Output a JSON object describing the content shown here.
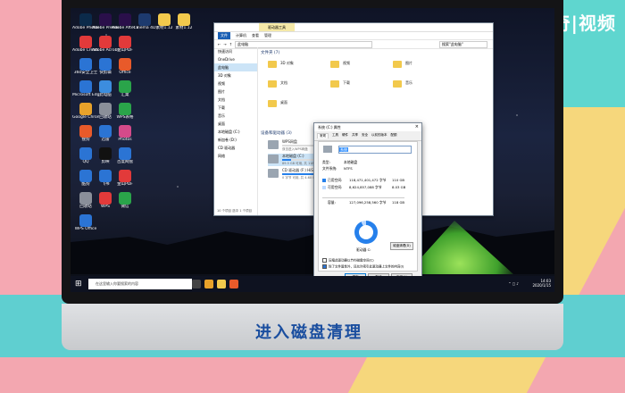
{
  "brand": {
    "text": "天奇|视频"
  },
  "caption": {
    "text": "进入磁盘清理"
  },
  "desktop_icons": [
    {
      "label": "Adobe Photosh...",
      "color": "#0b2a4a"
    },
    {
      "label": "Adobe Premiere P...",
      "color": "#2a0f4a"
    },
    {
      "label": "Adobe After Effects CC",
      "color": "#2a0f4a"
    },
    {
      "label": "Cinema 4D",
      "color": "#1d3a6e"
    },
    {
      "label": "素材1.12",
      "color": "#f2c94c"
    },
    {
      "label": "素材1.12",
      "color": "#f2c94c"
    },
    {
      "label": "Adobe Creati...",
      "color": "#e23a3a"
    },
    {
      "label": "Adobe Acrobat",
      "color": "#e23a3a"
    },
    {
      "label": "金山PDF",
      "color": "#e23a3a"
    },
    {
      "label": "360安全卫士",
      "color": "#2b74d4"
    },
    {
      "label": "快剪辑",
      "color": "#2b74d4"
    },
    {
      "label": "Office",
      "color": "#e85a2a"
    },
    {
      "label": "Microsoft Edge",
      "color": "#2b74d4"
    },
    {
      "label": "此电脑",
      "color": "#3c8dde"
    },
    {
      "label": "汇桌",
      "color": "#2aa44a"
    },
    {
      "label": "Google Chrome",
      "color": "#e8a22a"
    },
    {
      "label": "回收站",
      "color": "#8a8f99"
    },
    {
      "label": "WPS表格",
      "color": "#2aa44a"
    },
    {
      "label": "搜狗",
      "color": "#e85a2a"
    },
    {
      "label": "迅雷",
      "color": "#2b74d4"
    },
    {
      "label": "Photos",
      "color": "#d44a8a"
    },
    {
      "label": "QQ",
      "color": "#2b74d4"
    },
    {
      "label": "剪映",
      "color": "#111"
    },
    {
      "label": "百度网盘",
      "color": "#2b74d4"
    },
    {
      "label": "酷狗",
      "color": "#2b74d4"
    },
    {
      "label": "飞书",
      "color": "#2b74d4"
    },
    {
      "label": "金山PDF",
      "color": "#e23a3a"
    },
    {
      "label": "回收站",
      "color": "#8a8f99"
    },
    {
      "label": "WPS",
      "color": "#e23a3a"
    },
    {
      "label": "微信",
      "color": "#2aa44a"
    },
    {
      "label": "WPS Office",
      "color": "#2b74d4"
    }
  ],
  "explorer": {
    "ribbon_tag": "驱动器工具",
    "tabs": [
      "文件",
      "计算机",
      "查看",
      "管理"
    ],
    "active_tab": "文件",
    "address": "此电脑",
    "search_placeholder": "搜索\"此电脑\"",
    "nav": [
      "快速访问",
      "OneDrive",
      "此电脑",
      "3D 对象",
      "视频",
      "图片",
      "文档",
      "下载",
      "音乐",
      "桌面",
      "本地磁盘 (C:)",
      "新加卷 (D:)",
      "CD 驱动器",
      "网络"
    ],
    "nav_selected": "此电脑",
    "section_folders": "文件夹 (7)",
    "folders": [
      "3D 对象",
      "视频",
      "图片",
      "文档",
      "下载",
      "音乐",
      "桌面"
    ],
    "section_drives": "设备和驱动器 (3)",
    "drives": [
      {
        "name": "WPS网盘",
        "sub": "双击进入WPS网盘",
        "fill": 0
      },
      {
        "name": "本地磁盘 (C:)",
        "sub": "89.5 GB 可用, 共 118 GB",
        "fill": 0.24,
        "selected": true
      },
      {
        "name": "CD 驱动器 (F:) HiSuite",
        "sub": "0 字节 可用, 共 4.60 MB",
        "fill": 1
      }
    ],
    "status": "10 个项目    选中 1 个项目"
  },
  "dialog": {
    "title": "系统 (C:) 属性",
    "close": "×",
    "tabs": [
      "常规",
      "工具",
      "硬件",
      "共享",
      "安全",
      "以前的版本",
      "配额"
    ],
    "active_tab": "常规",
    "drive_name": "系统",
    "type_label": "类型:",
    "type_value": "本地磁盘",
    "fs_label": "文件系统:",
    "fs_value": "NTFS",
    "used_label": "已用空间:",
    "used_bytes": "118,471,401,472 字节",
    "used_gb": "110 GB",
    "free_label": "可用空间:",
    "free_bytes": "8,624,857,088 字节",
    "free_gb": "8.03 GB",
    "cap_label": "容量:",
    "cap_bytes": "127,096,258,560 字节",
    "cap_gb": "118 GB",
    "used_fraction": 0.93,
    "drive_label": "驱动器 C:",
    "cleanup_button": "磁盘清理(D)",
    "check1": "压缩此驱动器以节约磁盘空间(C)",
    "check2": "除了文件属性外，还允许索引此驱动器上文件的内容(I)",
    "ok": "确定",
    "cancel": "取消",
    "apply": "应用(A)",
    "colors": {
      "used": "#2680eb",
      "free": "#bcd9ff"
    }
  },
  "taskbar": {
    "search_placeholder": "在这里输入你要搜索的内容",
    "time": "14:03",
    "date": "2020/1/15"
  }
}
